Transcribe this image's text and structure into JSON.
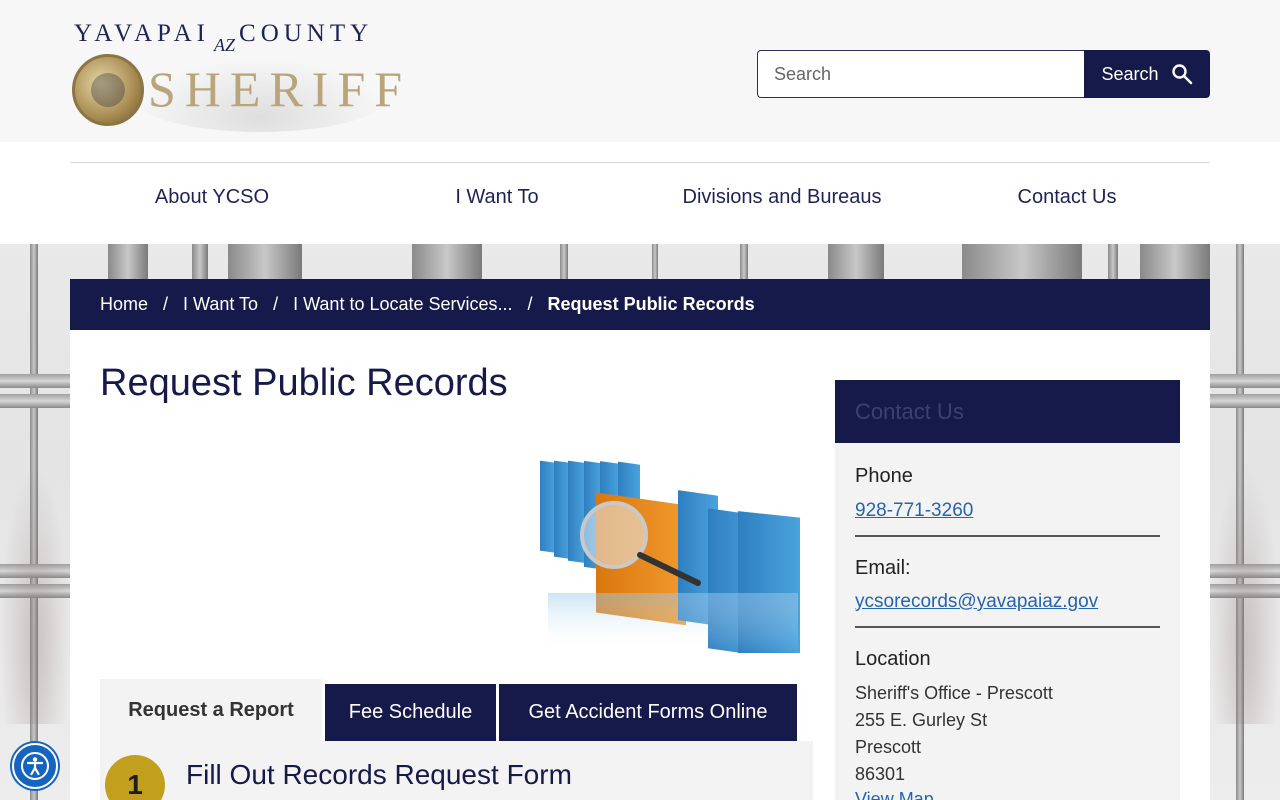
{
  "header": {
    "logo": {
      "top_left": "YAVAPAI",
      "az": "AZ",
      "top_right": "COUNTY",
      "sheriff": "SHERIFF"
    },
    "search": {
      "placeholder": "Search",
      "button_label": "Search",
      "icon": "search-icon"
    }
  },
  "nav": {
    "items": [
      {
        "label": "About YCSO"
      },
      {
        "label": "I Want To"
      },
      {
        "label": "Divisions and Bureaus"
      },
      {
        "label": "Contact Us"
      }
    ]
  },
  "breadcrumb": {
    "items": [
      "Home",
      "I Want To",
      "I Want to Locate Services...",
      "Request Public Records"
    ],
    "separator": "/"
  },
  "main": {
    "title": "Request Public Records",
    "tabs": [
      {
        "label": "Request a Report",
        "active": true
      },
      {
        "label": "Fee Schedule",
        "active": false
      },
      {
        "label": "Get Accident Forms Online",
        "active": false
      }
    ],
    "step": {
      "number": "1",
      "title": "Fill Out Records Request Form"
    }
  },
  "sidebar": {
    "heading": "Contact Us",
    "phone_label": "Phone",
    "phone": "928-771-3260",
    "email_label": "Email:",
    "email": "ycsorecords@yavapaiaz.gov",
    "location_label": "Location",
    "address": [
      "Sheriff's Office - Prescott",
      "255 E. Gurley St",
      "Prescott",
      "86301"
    ],
    "map_link": "View Map"
  },
  "colors": {
    "navy": "#161a4a",
    "gold": "#c2a01d",
    "link": "#2564b0",
    "accessibility": "#1565c0"
  },
  "icons": {
    "accessibility": "accessibility-icon"
  }
}
